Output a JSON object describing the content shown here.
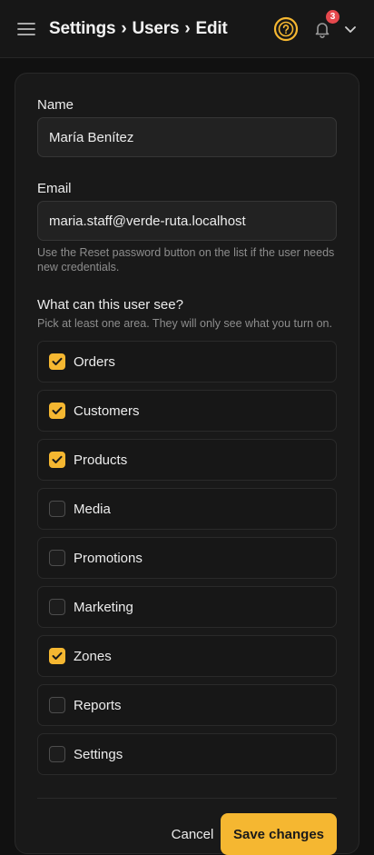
{
  "header": {
    "menu_icon": "hamburger-menu-icon",
    "breadcrumb": [
      "Settings",
      "Users",
      "Edit"
    ],
    "separator": "›",
    "help_icon": "help-circle-icon",
    "notifications_icon": "bell-icon",
    "notifications_count": "3",
    "account_icon": "chevron-down-icon",
    "accent_color": "#f5b731",
    "badge_color": "#e5484d"
  },
  "form": {
    "name_label": "Name",
    "name_value": "María Benítez",
    "email_label": "Email",
    "email_value": "maria.staff@verde-ruta.localhost",
    "email_hint": "Use the Reset password button on the list if the user needs new credentials.",
    "permissions_title": "What can this user see?",
    "permissions_hint": "Pick at least one area. They will only see what you turn on.",
    "permissions": [
      {
        "label": "Orders",
        "checked": true
      },
      {
        "label": "Customers",
        "checked": true
      },
      {
        "label": "Products",
        "checked": true
      },
      {
        "label": "Media",
        "checked": false
      },
      {
        "label": "Promotions",
        "checked": false
      },
      {
        "label": "Marketing",
        "checked": false
      },
      {
        "label": "Zones",
        "checked": true
      },
      {
        "label": "Reports",
        "checked": false
      },
      {
        "label": "Settings",
        "checked": false
      }
    ],
    "cancel_label": "Cancel",
    "save_label": "Save changes"
  }
}
